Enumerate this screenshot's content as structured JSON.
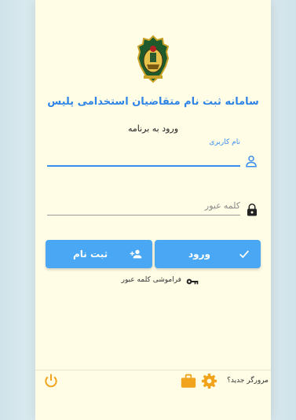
{
  "app": {
    "title": "سامانه ثبت نام متقاضیان استخدامی پلیس",
    "subtitle": "ورود به برنامه",
    "logo_icon": "police-emblem-icon"
  },
  "login_form": {
    "username_label": "نام کاربری",
    "username_value": "",
    "password_placeholder": "کلمه عبور",
    "password_value": "",
    "username_icon": "user-icon",
    "password_icon": "lock-icon"
  },
  "buttons": {
    "login_label": "ورود",
    "login_icon": "check-icon",
    "register_label": "ثبت نام",
    "register_icon": "add-user-icon",
    "color": "#49a7f3"
  },
  "forgot_password": {
    "label": "فراموشی کلمه عبور",
    "icon": "key-icon"
  },
  "footer": {
    "new_browser_label": "مرورگر جدید؟",
    "settings_icon": "gear-icon",
    "briefcase_icon": "briefcase-icon",
    "power_icon": "power-icon",
    "accent_color": "#f0a31b"
  },
  "colors": {
    "title": "#2f84e6",
    "card_background": "#fffde5",
    "field_focus": "#3a8ef0"
  }
}
